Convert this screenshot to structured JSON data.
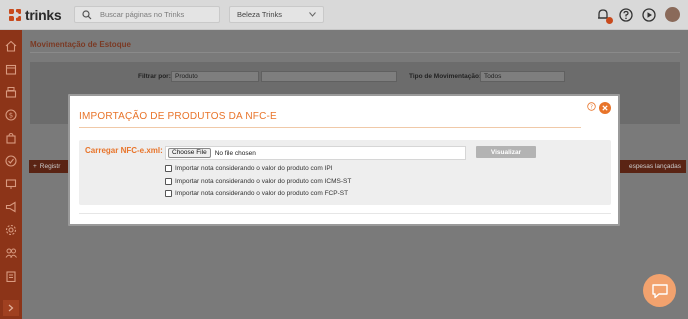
{
  "header": {
    "logo_text": "trinks",
    "search_placeholder": "Buscar páginas no Trinks",
    "unit_selected": "Beleza Trinks",
    "icons": [
      "notification-icon",
      "help-icon",
      "play-icon",
      "avatar"
    ]
  },
  "sidebar": {
    "icons": [
      "home-icon",
      "calendar-icon",
      "cash-register-icon",
      "dollar-icon",
      "bag-icon",
      "check-icon",
      "monitor-icon",
      "megaphone-icon",
      "gear-icon",
      "box-icon",
      "users-icon",
      "clipboard-icon"
    ]
  },
  "page": {
    "title": "Movimentação de Estoque",
    "filter_by_label": "Filtrar por:",
    "filter_by_value": "Produto",
    "movement_type_label": "Tipo de Movimentação:",
    "movement_type_value": "Todos",
    "register_button": "Registr",
    "despesas_button": "espesas lançadas"
  },
  "modal": {
    "title": "IMPORTAÇÃO DE PRODUTOS DA NFC-E",
    "upload_label": "Carregar NFC-e.xml:",
    "file_button": "Choose File",
    "file_status": "No file chosen",
    "preview_button": "Visualizar",
    "options": [
      {
        "label": "Importar nota considerando o valor do produto com IPI",
        "checked": false
      },
      {
        "label": "Importar nota considerando o valor do produto com ICMS-ST",
        "checked": false
      },
      {
        "label": "Importar nota considerando o valor do produto com FCP-ST",
        "checked": false
      }
    ]
  },
  "colors": {
    "accent": "#e8742a",
    "sidebar": "#8c3418",
    "topbar": "#d9d9d9"
  }
}
